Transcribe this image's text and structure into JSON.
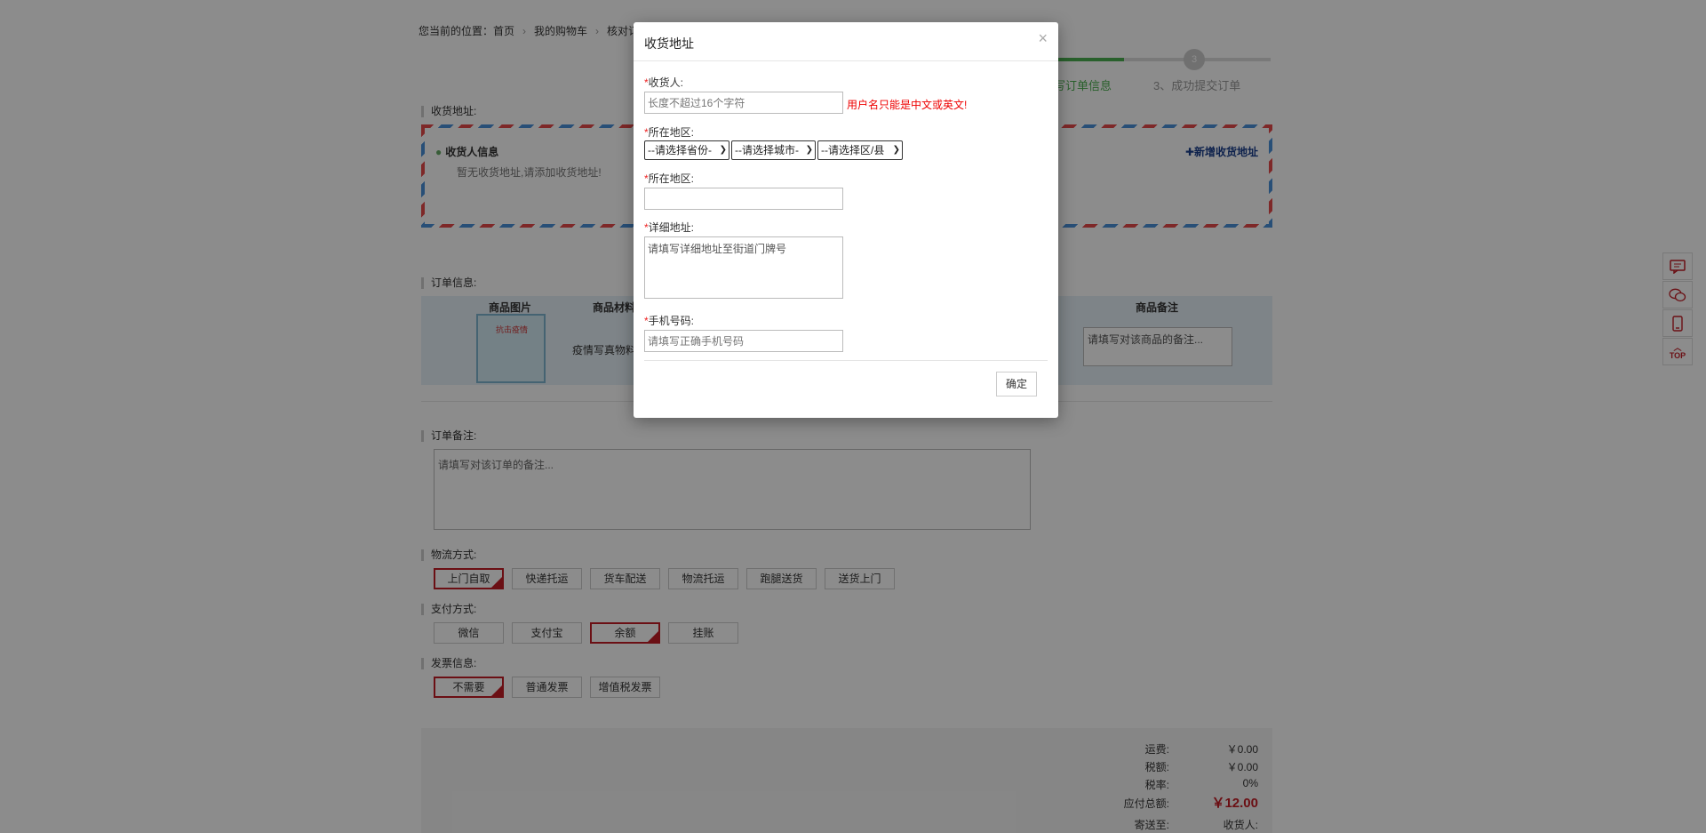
{
  "breadcrumb": {
    "prefix": "您当前的位置：",
    "items": [
      "首页",
      "我的购物车",
      "核对订"
    ]
  },
  "steps": [
    {
      "num": "",
      "label": "写订单信息"
    },
    {
      "num": "3",
      "label": "3、成功提交订单"
    }
  ],
  "address_section": {
    "title": "收货地址:",
    "receiver_info": "收货人信息",
    "empty_text": "暂无收货地址,请添加收货地址!",
    "add_link": "✚新增收货地址"
  },
  "order_section": {
    "title": "订单信息:",
    "headers": {
      "image": "商品图片",
      "material": "商品材料",
      "note": "商品备注"
    },
    "product": {
      "name": "疫情写真物料",
      "image_text": "抗击疫情",
      "note_placeholder": "请填写对该商品的备注..."
    }
  },
  "remark_section": {
    "title": "订单备注:",
    "placeholder": "请填写对该订单的备注..."
  },
  "logistics": {
    "title": "物流方式:",
    "options": [
      "上门自取",
      "快递托运",
      "货车配送",
      "物流托运",
      "跑腿送货",
      "送货上门"
    ],
    "selected": "上门自取"
  },
  "payment": {
    "title": "支付方式:",
    "options": [
      "微信",
      "支付宝",
      "余额",
      "挂账"
    ],
    "selected": "余额"
  },
  "invoice": {
    "title": "发票信息:",
    "options": [
      "不需要",
      "普通发票",
      "增值税发票"
    ],
    "selected": "不需要"
  },
  "summary": {
    "freight_label": "运费:",
    "freight": "￥0.00",
    "tax_label": "税额:",
    "tax": "￥0.00",
    "rate_label": "税率:",
    "rate": "0%",
    "total_label": "应付总额:",
    "total": "￥12.00",
    "ship_to_label": "寄送至:",
    "receiver_label": "收货人:"
  },
  "side_tools": [
    "chat-icon",
    "wechat-icon",
    "phone-icon",
    "top-icon"
  ],
  "side_top_text": "TOP",
  "modal": {
    "title": "收货地址",
    "close": "×",
    "req_mark": "*",
    "receiver_label": "收货人:",
    "receiver_placeholder": "长度不超过16个字符",
    "receiver_error": "用户名只能是中文或英文!",
    "region_label": "所在地区:",
    "province": "--请选择省份-",
    "city": "--请选择城市-",
    "district": "--请选择区/县",
    "region_label2": "所在地区:",
    "detail_label": "详细地址:",
    "detail_placeholder": "请填写详细地址至街道门牌号",
    "phone_label": "手机号码:",
    "phone_placeholder": "请填写正确手机号码",
    "ok": "确定"
  },
  "colors": {
    "accent_red": "#c31d26",
    "step_green": "#4caf50",
    "link_blue": "#1a3e8c",
    "error_red": "#e00"
  }
}
